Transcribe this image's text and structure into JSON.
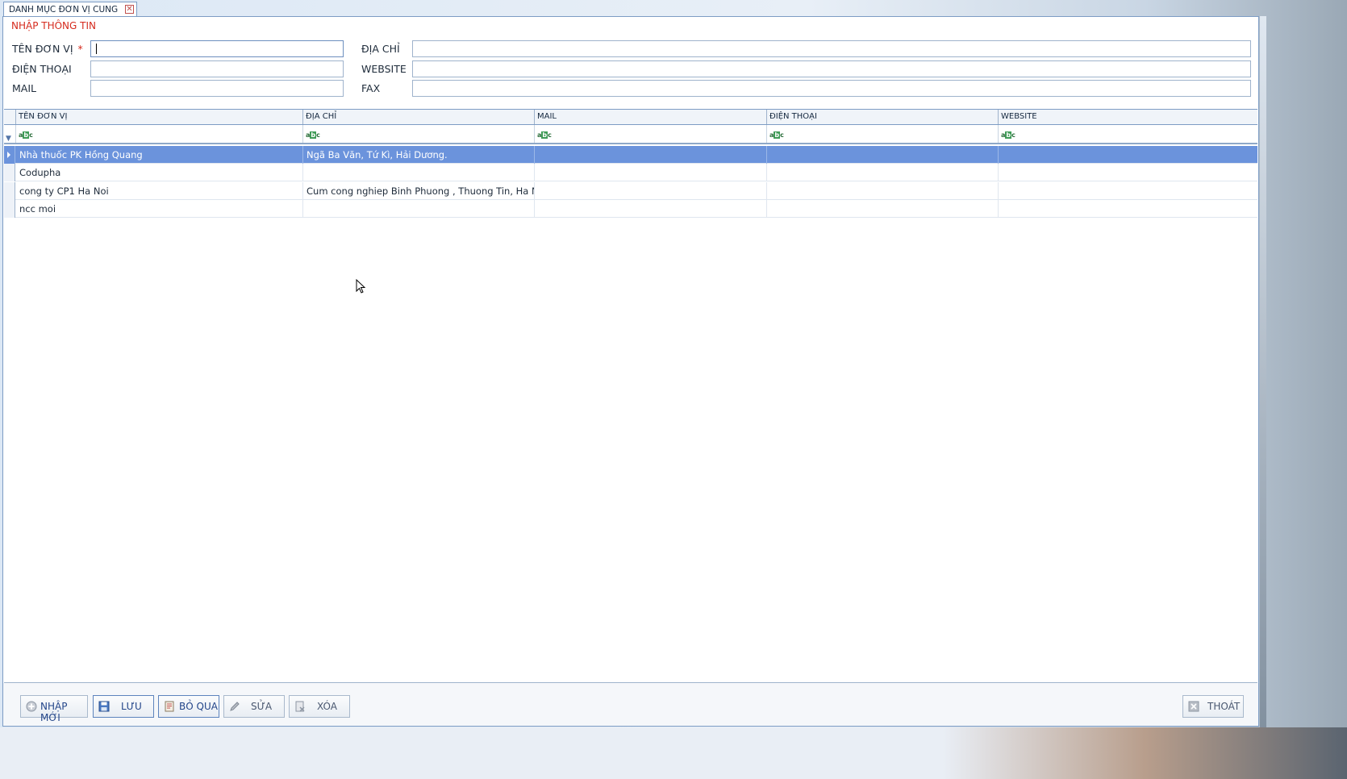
{
  "tab": {
    "title": "DANH MỤC ĐƠN VỊ CUNG CẤP",
    "close": "✕"
  },
  "form": {
    "section_title": "NHẬP THÔNG TIN",
    "required_mark": "*",
    "labels": {
      "ten_don_vi": "TÊN ĐƠN VỊ",
      "dien_thoai": "ĐIỆN THOẠI",
      "mail": "MAIL",
      "dia_chi": "ĐỊA CHỈ",
      "website": "WEBSITE",
      "fax": "FAX"
    },
    "values": {
      "ten_don_vi": "",
      "dien_thoai": "",
      "mail": "",
      "dia_chi": "",
      "website": "",
      "fax": ""
    }
  },
  "grid": {
    "columns": [
      "TÊN ĐƠN VỊ",
      "ĐỊA CHỈ",
      "MAIL",
      "ĐIỆN THOẠI",
      "WEBSITE"
    ],
    "filter_icon_label": "abc",
    "rows": [
      {
        "ten": "Nhà thuốc PK Hồng Quang",
        "dia_chi": " Ngã Ba Văn, Tứ Kì, Hải Dương.",
        "mail": "",
        "dien_thoai": "",
        "website": "",
        "selected": true
      },
      {
        "ten": "Codupha",
        "dia_chi": "",
        "mail": "",
        "dien_thoai": "",
        "website": "",
        "selected": false
      },
      {
        "ten": "cong ty CP1 Ha Noi",
        "dia_chi": "Cum cong nghiep Binh Phuong , Thuong Tin, Ha Noi",
        "mail": "",
        "dien_thoai": "",
        "website": "",
        "selected": false
      },
      {
        "ten": "ncc moi",
        "dia_chi": "",
        "mail": "",
        "dien_thoai": "",
        "website": "",
        "selected": false
      }
    ]
  },
  "buttons": {
    "nhap_moi": "NHẬP MỚI",
    "luu": "LƯU",
    "bo_qua": "BỎ QUA",
    "sua": "SỬA",
    "xoa": "XÓA",
    "thoat": "THOÁT"
  },
  "icons": {
    "nhap_moi": "plus-circle-icon",
    "luu": "save-icon",
    "bo_qua": "undo-icon",
    "sua": "edit-icon",
    "xoa": "delete-icon",
    "thoat": "close-icon"
  },
  "colors": {
    "accent": "#d52b1e",
    "selected_row": "#6b93dc",
    "border": "#7d9cc4"
  }
}
